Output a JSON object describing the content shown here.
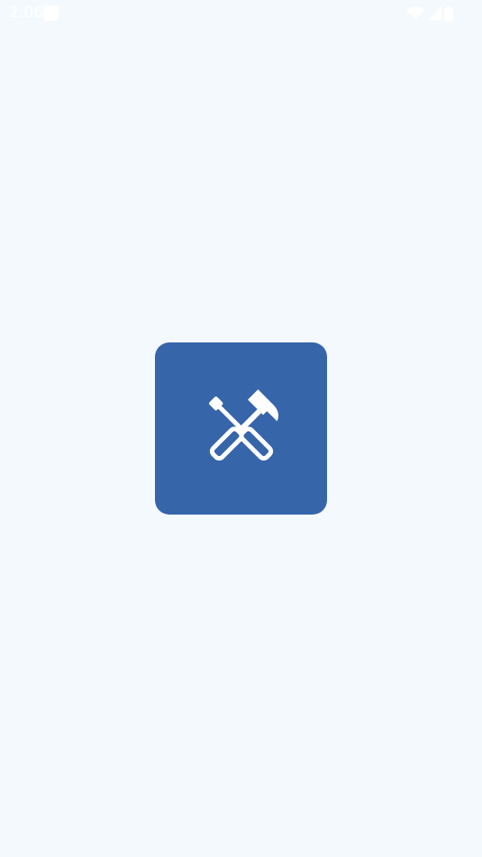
{
  "status_bar": {
    "time": "2:06",
    "icons": [
      "notification-icon",
      "wifi-icon",
      "signal-icon",
      "battery-icon"
    ]
  },
  "splash": {
    "logo_icon": "tools-icon",
    "logo_background": "#3665a9",
    "page_background": "#f4f9fe"
  }
}
